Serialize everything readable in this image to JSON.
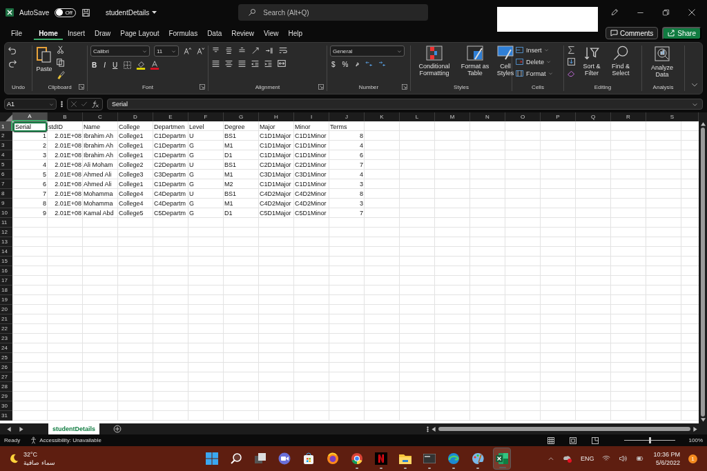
{
  "title_bar": {
    "autosave_label": "AutoSave",
    "autosave_toggle": {
      "label": "Off",
      "on": false
    },
    "file_name": "studentDetails",
    "search": {
      "placeholder": "Search (Alt+Q)"
    }
  },
  "menu_tabs": [
    {
      "label": "File",
      "selected": false
    },
    {
      "label": "Home",
      "selected": true
    },
    {
      "label": "Insert",
      "selected": false
    },
    {
      "label": "Draw",
      "selected": false
    },
    {
      "label": "Page Layout",
      "selected": false
    },
    {
      "label": "Formulas",
      "selected": false
    },
    {
      "label": "Data",
      "selected": false
    },
    {
      "label": "Review",
      "selected": false
    },
    {
      "label": "View",
      "selected": false
    },
    {
      "label": "Help",
      "selected": false
    }
  ],
  "actions": {
    "comments": "Comments",
    "share": "Share"
  },
  "ribbon": {
    "groups": [
      {
        "kind": "undo",
        "label": "Undo"
      },
      {
        "kind": "clipboard",
        "label": "Clipboard",
        "paste": "Paste"
      },
      {
        "kind": "font",
        "label": "Font",
        "font_name": "Calibri",
        "font_size": "11",
        "bold": "B",
        "italic": "I",
        "underline": "U"
      },
      {
        "kind": "alignment",
        "label": "Alignment"
      },
      {
        "kind": "number",
        "label": "Number",
        "format": "General",
        "currency": "$",
        "percent": "%"
      },
      {
        "kind": "styles",
        "label": "Styles",
        "buttons": [
          "Conditional Formatting",
          "Format as Table",
          "Cell Styles"
        ]
      },
      {
        "kind": "cells",
        "label": "Cells",
        "buttons": [
          "Insert",
          "Delete",
          "Format"
        ]
      },
      {
        "kind": "editing",
        "label": "Editing",
        "buttons": [
          "Sort & Filter",
          "Find & Select"
        ]
      },
      {
        "kind": "analysis",
        "label": "Analysis",
        "buttons": [
          "Analyze Data"
        ]
      }
    ]
  },
  "formula_bar": {
    "name_box": "A1",
    "formula": "Serial"
  },
  "sheet": {
    "columns": [
      {
        "label": "A",
        "selected": true
      },
      {
        "label": "B",
        "selected": false
      },
      {
        "label": "C",
        "selected": false
      },
      {
        "label": "D",
        "selected": false
      },
      {
        "label": "E",
        "selected": false
      },
      {
        "label": "F",
        "selected": false
      },
      {
        "label": "G",
        "selected": false
      },
      {
        "label": "H",
        "selected": false
      },
      {
        "label": "I",
        "selected": false
      },
      {
        "label": "J",
        "selected": false
      },
      {
        "label": "K",
        "selected": false
      },
      {
        "label": "L",
        "selected": false
      },
      {
        "label": "M",
        "selected": false
      },
      {
        "label": "N",
        "selected": false
      },
      {
        "label": "O",
        "selected": false
      },
      {
        "label": "P",
        "selected": false
      },
      {
        "label": "Q",
        "selected": false
      },
      {
        "label": "R",
        "selected": false
      },
      {
        "label": "S",
        "selected": false
      }
    ],
    "rows": [
      {
        "number": "1",
        "selected": true,
        "cells": [
          {
            "text": "Serial",
            "kind": "text"
          },
          {
            "text": "stdID",
            "kind": "text"
          },
          {
            "text": "Name",
            "kind": "text"
          },
          {
            "text": "College",
            "kind": "text"
          },
          {
            "text": "Departmen",
            "kind": "text"
          },
          {
            "text": "Level",
            "kind": "text"
          },
          {
            "text": "Degree",
            "kind": "text"
          },
          {
            "text": "Major",
            "kind": "text"
          },
          {
            "text": "Minor",
            "kind": "text"
          },
          {
            "text": "Terms",
            "kind": "text"
          }
        ]
      },
      {
        "number": "2",
        "selected": false,
        "cells": [
          {
            "text": "1",
            "kind": "number"
          },
          {
            "text": "2.01E+08",
            "kind": "number"
          },
          {
            "text": "Ibrahim Ah",
            "kind": "text"
          },
          {
            "text": "College1",
            "kind": "text"
          },
          {
            "text": "C1Departm",
            "kind": "text"
          },
          {
            "text": "U",
            "kind": "text"
          },
          {
            "text": "BS1",
            "kind": "text"
          },
          {
            "text": "C1D1Major",
            "kind": "text"
          },
          {
            "text": "C1D1Minor",
            "kind": "text"
          },
          {
            "text": "8",
            "kind": "number"
          }
        ]
      },
      {
        "number": "3",
        "selected": false,
        "cells": [
          {
            "text": "2",
            "kind": "number"
          },
          {
            "text": "2.01E+08",
            "kind": "number"
          },
          {
            "text": "Ibrahim Ah",
            "kind": "text"
          },
          {
            "text": "College1",
            "kind": "text"
          },
          {
            "text": "C1Departm",
            "kind": "text"
          },
          {
            "text": "G",
            "kind": "text"
          },
          {
            "text": "M1",
            "kind": "text"
          },
          {
            "text": "C1D1Major",
            "kind": "text"
          },
          {
            "text": "C1D1Minor",
            "kind": "text"
          },
          {
            "text": "4",
            "kind": "number"
          }
        ]
      },
      {
        "number": "4",
        "selected": false,
        "cells": [
          {
            "text": "3",
            "kind": "number"
          },
          {
            "text": "2.01E+08",
            "kind": "number"
          },
          {
            "text": "Ibrahim Ah",
            "kind": "text"
          },
          {
            "text": "College1",
            "kind": "text"
          },
          {
            "text": "C1Departm",
            "kind": "text"
          },
          {
            "text": "G",
            "kind": "text"
          },
          {
            "text": "D1",
            "kind": "text"
          },
          {
            "text": "C1D1Major",
            "kind": "text"
          },
          {
            "text": "C1D1Minor",
            "kind": "text"
          },
          {
            "text": "6",
            "kind": "number"
          }
        ]
      },
      {
        "number": "5",
        "selected": false,
        "cells": [
          {
            "text": "4",
            "kind": "number"
          },
          {
            "text": "2.01E+08",
            "kind": "number"
          },
          {
            "text": "Ali Moham",
            "kind": "text"
          },
          {
            "text": "College2",
            "kind": "text"
          },
          {
            "text": "C2Departm",
            "kind": "text"
          },
          {
            "text": "U",
            "kind": "text"
          },
          {
            "text": "BS1",
            "kind": "text"
          },
          {
            "text": "C2D1Major",
            "kind": "text"
          },
          {
            "text": "C2D1Minor",
            "kind": "text"
          },
          {
            "text": "7",
            "kind": "number"
          }
        ]
      },
      {
        "number": "6",
        "selected": false,
        "cells": [
          {
            "text": "5",
            "kind": "number"
          },
          {
            "text": "2.01E+08",
            "kind": "number"
          },
          {
            "text": "Ahmed Ali",
            "kind": "text"
          },
          {
            "text": "College3",
            "kind": "text"
          },
          {
            "text": "C3Departm",
            "kind": "text"
          },
          {
            "text": "G",
            "kind": "text"
          },
          {
            "text": "M1",
            "kind": "text"
          },
          {
            "text": "C3D1Major",
            "kind": "text"
          },
          {
            "text": "C3D1Minor",
            "kind": "text"
          },
          {
            "text": "4",
            "kind": "number"
          }
        ]
      },
      {
        "number": "7",
        "selected": false,
        "cells": [
          {
            "text": "6",
            "kind": "number"
          },
          {
            "text": "2.01E+08",
            "kind": "number"
          },
          {
            "text": "Ahmed Ali",
            "kind": "text"
          },
          {
            "text": "College1",
            "kind": "text"
          },
          {
            "text": "C1Departm",
            "kind": "text"
          },
          {
            "text": "G",
            "kind": "text"
          },
          {
            "text": "M2",
            "kind": "text"
          },
          {
            "text": "C1D1Major",
            "kind": "text"
          },
          {
            "text": "C1D1Minor",
            "kind": "text"
          },
          {
            "text": "3",
            "kind": "number"
          }
        ]
      },
      {
        "number": "8",
        "selected": false,
        "cells": [
          {
            "text": "7",
            "kind": "number"
          },
          {
            "text": "2.01E+08",
            "kind": "number"
          },
          {
            "text": "Mohamma",
            "kind": "text"
          },
          {
            "text": "College4",
            "kind": "text"
          },
          {
            "text": "C4Departm",
            "kind": "text"
          },
          {
            "text": "U",
            "kind": "text"
          },
          {
            "text": "BS1",
            "kind": "text"
          },
          {
            "text": "C4D2Major",
            "kind": "text"
          },
          {
            "text": "C4D2Minor",
            "kind": "text"
          },
          {
            "text": "8",
            "kind": "number"
          }
        ]
      },
      {
        "number": "9",
        "selected": false,
        "cells": [
          {
            "text": "8",
            "kind": "number"
          },
          {
            "text": "2.01E+08",
            "kind": "number"
          },
          {
            "text": "Mohamma",
            "kind": "text"
          },
          {
            "text": "College4",
            "kind": "text"
          },
          {
            "text": "C4Departm",
            "kind": "text"
          },
          {
            "text": "G",
            "kind": "text"
          },
          {
            "text": "M1",
            "kind": "text"
          },
          {
            "text": "C4D2Major",
            "kind": "text"
          },
          {
            "text": "C4D2Minor",
            "kind": "text"
          },
          {
            "text": "3",
            "kind": "number"
          }
        ]
      },
      {
        "number": "10",
        "selected": false,
        "cells": [
          {
            "text": "9",
            "kind": "number"
          },
          {
            "text": "2.01E+08",
            "kind": "number"
          },
          {
            "text": "Kamal Abd",
            "kind": "text"
          },
          {
            "text": "College5",
            "kind": "text"
          },
          {
            "text": "C5Departm",
            "kind": "text"
          },
          {
            "text": "G",
            "kind": "text"
          },
          {
            "text": "D1",
            "kind": "text"
          },
          {
            "text": "C5D1Major",
            "kind": "text"
          },
          {
            "text": "C5D1Minor",
            "kind": "text"
          },
          {
            "text": "7",
            "kind": "number"
          }
        ]
      },
      {
        "number": "11",
        "selected": false
      },
      {
        "number": "12",
        "selected": false
      },
      {
        "number": "13",
        "selected": false
      },
      {
        "number": "14",
        "selected": false
      },
      {
        "number": "15",
        "selected": false
      },
      {
        "number": "16",
        "selected": false
      },
      {
        "number": "17",
        "selected": false
      },
      {
        "number": "18",
        "selected": false
      },
      {
        "number": "19",
        "selected": false
      },
      {
        "number": "20",
        "selected": false
      },
      {
        "number": "21",
        "selected": false
      },
      {
        "number": "22",
        "selected": false
      },
      {
        "number": "23",
        "selected": false
      },
      {
        "number": "24",
        "selected": false
      },
      {
        "number": "25",
        "selected": false
      },
      {
        "number": "26",
        "selected": false
      },
      {
        "number": "27",
        "selected": false
      },
      {
        "number": "28",
        "selected": false
      },
      {
        "number": "29",
        "selected": false
      },
      {
        "number": "30",
        "selected": false
      },
      {
        "number": "31",
        "selected": false
      }
    ]
  },
  "sheet_tabs": [
    {
      "label": "studentDetails",
      "selected": true
    }
  ],
  "status_bar": {
    "status": "Ready",
    "accessibility": "Accessibility: Unavailable",
    "zoom": "100%",
    "zoom_slider": {
      "level": 0.5
    }
  },
  "taskbar": {
    "weather": {
      "temperature": "32°C",
      "condition": "سماء صافية"
    },
    "apps": [
      {
        "kind": "start",
        "running": false,
        "selected": false
      },
      {
        "kind": "search",
        "running": false,
        "selected": false
      },
      {
        "kind": "task-view",
        "running": false,
        "selected": false
      },
      {
        "kind": "chat",
        "running": false,
        "selected": false
      },
      {
        "kind": "store",
        "running": false,
        "selected": false
      },
      {
        "kind": "fox-browser",
        "running": false,
        "selected": false
      },
      {
        "kind": "ring-browser",
        "running": true,
        "selected": false
      },
      {
        "kind": "media",
        "running": true,
        "selected": false
      },
      {
        "kind": "folder",
        "running": true,
        "selected": false
      },
      {
        "kind": "terminal",
        "running": true,
        "selected": false
      },
      {
        "kind": "wave-browser",
        "running": true,
        "selected": false
      },
      {
        "kind": "paint",
        "running": true,
        "selected": false
      },
      {
        "kind": "spreadsheet",
        "running": true,
        "selected": true
      }
    ],
    "language": "ENG",
    "time": "10:36 PM",
    "date": "5/6/2022",
    "notifications": "1"
  }
}
